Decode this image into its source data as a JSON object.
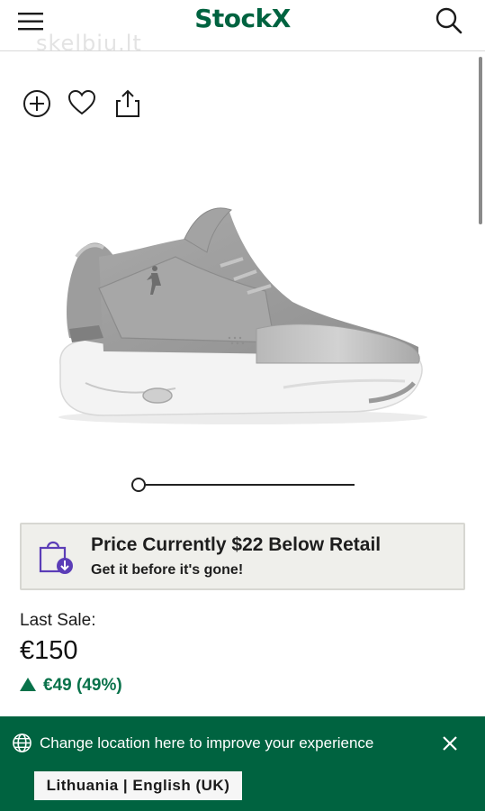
{
  "header": {
    "logo": "StockX",
    "menu_icon": "hamburger-menu-icon",
    "search_icon": "search-icon",
    "brand_color": "#006340"
  },
  "watermark": "skelbiu.lt",
  "actions": [
    {
      "icon": "add-circle-icon"
    },
    {
      "icon": "heart-icon"
    },
    {
      "icon": "share-icon"
    }
  ],
  "product": {
    "image": "grey-basketball-sneaker",
    "gallery_position": 0
  },
  "promo": {
    "icon": "shopping-bag-download-icon",
    "title": "Price Currently $22 Below Retail",
    "subtitle": "Get it before it's gone!"
  },
  "last_sale": {
    "label": "Last Sale:",
    "price": "€150",
    "change": "€49 (49%)",
    "change_direction": "up",
    "change_color": "#08724a"
  },
  "location_banner": {
    "icon": "globe-icon",
    "text": "Change location here to improve your experience",
    "close_icon": "close-icon",
    "locale_button": "Lithuania | English (UK)",
    "background": "#006340"
  }
}
